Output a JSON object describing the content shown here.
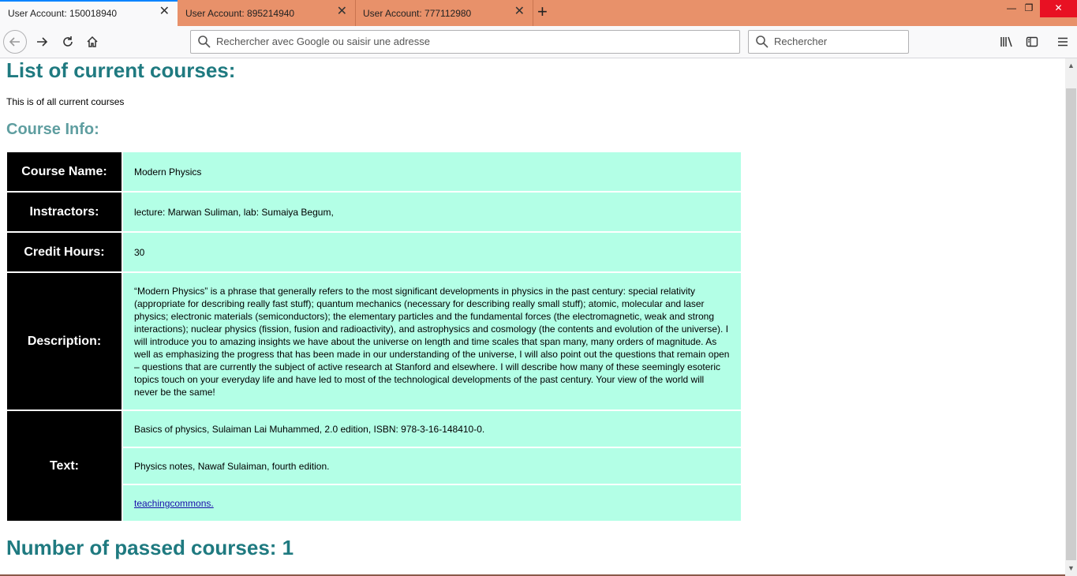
{
  "tabs": [
    {
      "label": "User Account: 150018940",
      "close": "✕",
      "active": true
    },
    {
      "label": "User Account: 895214940",
      "close": "✕",
      "active": false
    },
    {
      "label": "User Account: 777112980",
      "close": "✕",
      "active": false
    }
  ],
  "newtab_icon": "plus-icon",
  "window_controls": {
    "minimize": "—",
    "restore": "❐",
    "close": "✕"
  },
  "nav": {
    "back_icon": "arrow-left-icon",
    "forward_icon": "arrow-right-icon",
    "reload_icon": "reload-icon",
    "home_icon": "home-icon",
    "library_icon": "library-icon",
    "sidebar_icon": "sidebar-icon",
    "menu_icon": "hamburger-menu-icon"
  },
  "urlbar": {
    "placeholder": "Rechercher avec Google ou saisir une adresse",
    "value": ""
  },
  "searchbar": {
    "placeholder": "Rechercher",
    "value": ""
  },
  "page": {
    "title": "List of current courses:",
    "intro": "This is of all current courses",
    "section_title": "Course Info:",
    "course": {
      "name_label": "Course Name:",
      "name": "Modern Physics",
      "instructors_label": "Instractors:",
      "instructors": "lecture: Marwan Suliman, lab: Sumaiya Begum,",
      "credit_label": "Credit Hours:",
      "credit": "30",
      "description_label": "Description:",
      "description": "“Modern Physics” is a phrase that generally refers to the most significant developments in physics in the past century: special relativity (appropriate for describing really fast stuff); quantum mechanics (necessary for describing really small stuff); atomic, molecular and laser physics; electronic materials (semiconductors); the elementary particles and the fundamental forces (the electromagnetic, weak and strong interactions); nuclear physics (fission, fusion and radioactivity), and astrophysics and cosmology (the contents and evolution of the universe). I will introduce you to amazing insights we have about the universe on length and time scales that span many, many orders of magnitude. As well as emphasizing the progress that has been made in our understanding of the universe, I will also point out the questions that remain open – questions that are currently the subject of active research at Stanford and elsewhere. I will describe how many of these seemingly esoteric topics touch on your everyday life and have led to most of the technological developments of the past century. Your view of the world will never be the same!",
      "text_label": "Text:",
      "texts": [
        "Basics of physics,  Sulaiman  Lai  Muhammed,  2.0 edition, ISBN: 978-3-16-148410-0.",
        "Physics notes,  Nawaf  Sulaiman,  fourth edition."
      ],
      "text_link": "teachingcommons."
    },
    "passed": "Number of passed courses: 1"
  },
  "colors": {
    "tabstrip": "#e8916a",
    "heading": "#1f7a80",
    "subheading": "#5f9ea0",
    "label_bg": "#000000",
    "value_bg": "#b3ffe6"
  }
}
